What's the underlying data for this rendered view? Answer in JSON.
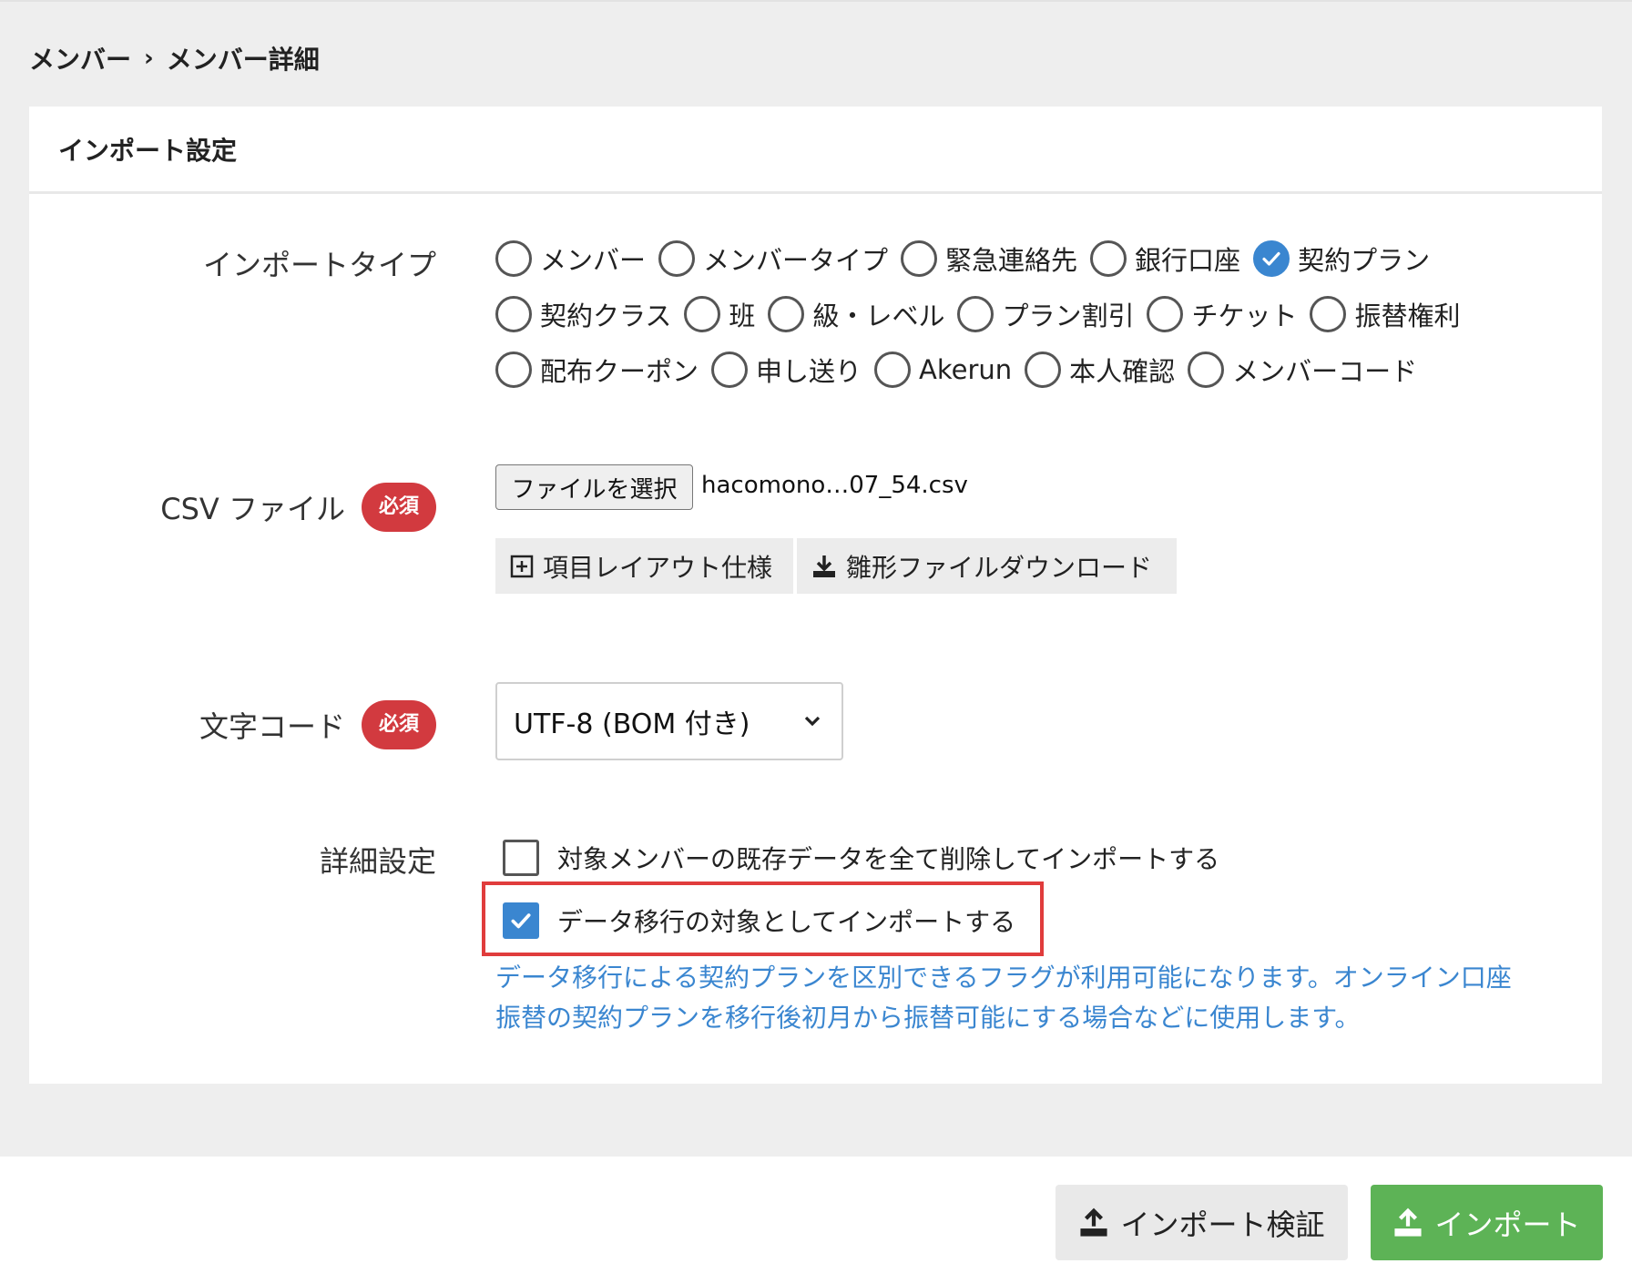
{
  "breadcrumb": {
    "parent": "メンバー",
    "current": "メンバー詳細"
  },
  "card": {
    "title": "インポート設定"
  },
  "import_type": {
    "label": "インポートタイプ",
    "options": [
      {
        "label": "メンバー",
        "checked": false
      },
      {
        "label": "メンバータイプ",
        "checked": false
      },
      {
        "label": "緊急連絡先",
        "checked": false
      },
      {
        "label": "銀行口座",
        "checked": false
      },
      {
        "label": "契約プラン",
        "checked": true
      },
      {
        "label": "契約クラス",
        "checked": false
      },
      {
        "label": "班",
        "checked": false
      },
      {
        "label": "級・レベル",
        "checked": false
      },
      {
        "label": "プラン割引",
        "checked": false
      },
      {
        "label": "チケット",
        "checked": false
      },
      {
        "label": "振替権利",
        "checked": false
      },
      {
        "label": "配布クーポン",
        "checked": false
      },
      {
        "label": "申し送り",
        "checked": false
      },
      {
        "label": "Akerun",
        "checked": false
      },
      {
        "label": "本人確認",
        "checked": false
      },
      {
        "label": "メンバーコード",
        "checked": false
      }
    ]
  },
  "csv_file": {
    "label": "CSV ファイル",
    "required_badge": "必須",
    "choose_button": "ファイルを選択",
    "file_name": "hacomono…07_54.csv",
    "layout_spec_button": "項目レイアウト仕様",
    "template_download_button": "雛形ファイルダウンロード"
  },
  "encoding": {
    "label": "文字コード",
    "required_badge": "必須",
    "selected": "UTF-8 (BOM 付き)"
  },
  "advanced": {
    "label": "詳細設定",
    "delete_existing": {
      "label": "対象メンバーの既存データを全て削除してインポートする",
      "checked": false
    },
    "data_migration": {
      "label": "データ移行の対象としてインポートする",
      "checked": true
    },
    "hint_line1": "データ移行による契約プランを区別できるフラグが利用可能になります。オンライン口座",
    "hint_line2": "振替の契約プランを移行後初月から振替可能にする場合などに使用します。"
  },
  "footer": {
    "verify_button": "インポート検証",
    "import_button": "インポート"
  },
  "colors": {
    "accent": "#3a86d0",
    "required": "#d23a3f",
    "import_green": "#5db356",
    "highlight_red": "#e03c3c"
  }
}
